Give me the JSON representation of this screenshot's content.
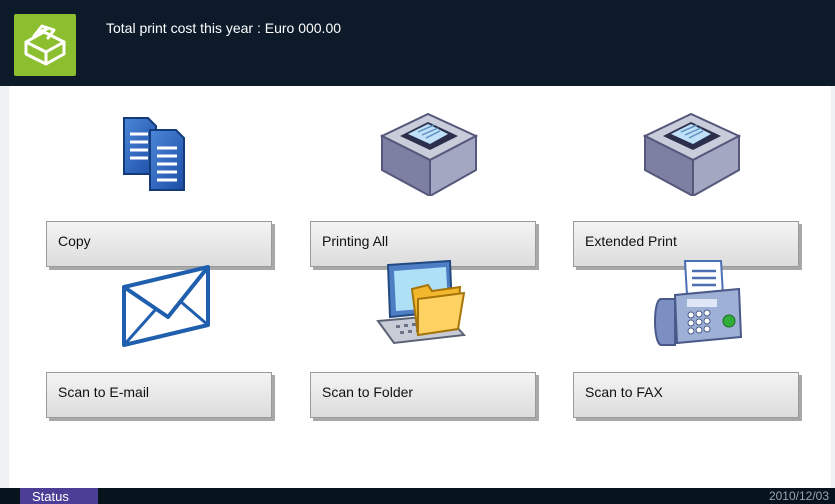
{
  "header": {
    "print_cost_text": "Total print cost this year : Euro 000.00",
    "logo_icon": "printer-box-icon"
  },
  "functions": [
    {
      "label": "Copy",
      "icon": "copy-icon"
    },
    {
      "label": "Printing All",
      "icon": "printer-icon"
    },
    {
      "label": "Extended Print",
      "icon": "printer-icon"
    },
    {
      "label": "Scan to E-mail",
      "icon": "envelope-icon"
    },
    {
      "label": "Scan to Folder",
      "icon": "folder-computer-icon"
    },
    {
      "label": "Scan to FAX",
      "icon": "fax-icon"
    }
  ],
  "status_bar": {
    "status_label": "Status",
    "date": "2010/12/03"
  },
  "colors": {
    "header_bg": "#0c1a2a",
    "logo_bg": "#8cbf2f",
    "status_btn_bg": "#4c3e97"
  }
}
